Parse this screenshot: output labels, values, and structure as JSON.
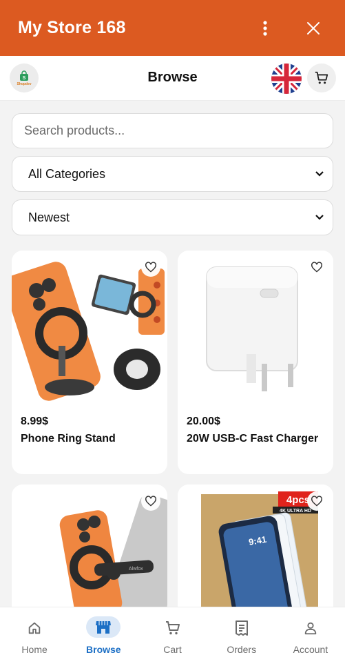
{
  "app": {
    "title": "My Store 168"
  },
  "header": {
    "page_title": "Browse",
    "logo_text": "Shopdev"
  },
  "search": {
    "placeholder": "Search products..."
  },
  "filters": {
    "category": "All Categories",
    "sort": "Newest"
  },
  "products": [
    {
      "price": "8.99$",
      "name": "Phone Ring Stand"
    },
    {
      "price": "20.00$",
      "name": "20W USB-C Fast Charger"
    },
    {
      "price": "",
      "name": "",
      "image_text": "Alwfox"
    },
    {
      "price": "",
      "name": "",
      "badge": "4pcs",
      "badge_sub": "4K ULTRA HD",
      "screen_time": "9:41"
    }
  ],
  "nav": {
    "items": [
      {
        "label": "Home",
        "icon": "home-icon"
      },
      {
        "label": "Browse",
        "icon": "store-icon"
      },
      {
        "label": "Cart",
        "icon": "cart-icon"
      },
      {
        "label": "Orders",
        "icon": "receipt-icon"
      },
      {
        "label": "Account",
        "icon": "user-icon"
      }
    ]
  },
  "colors": {
    "brand": "#dc5a21",
    "active_nav": "#1c6fc5",
    "active_nav_bg": "#dbe8f7"
  }
}
